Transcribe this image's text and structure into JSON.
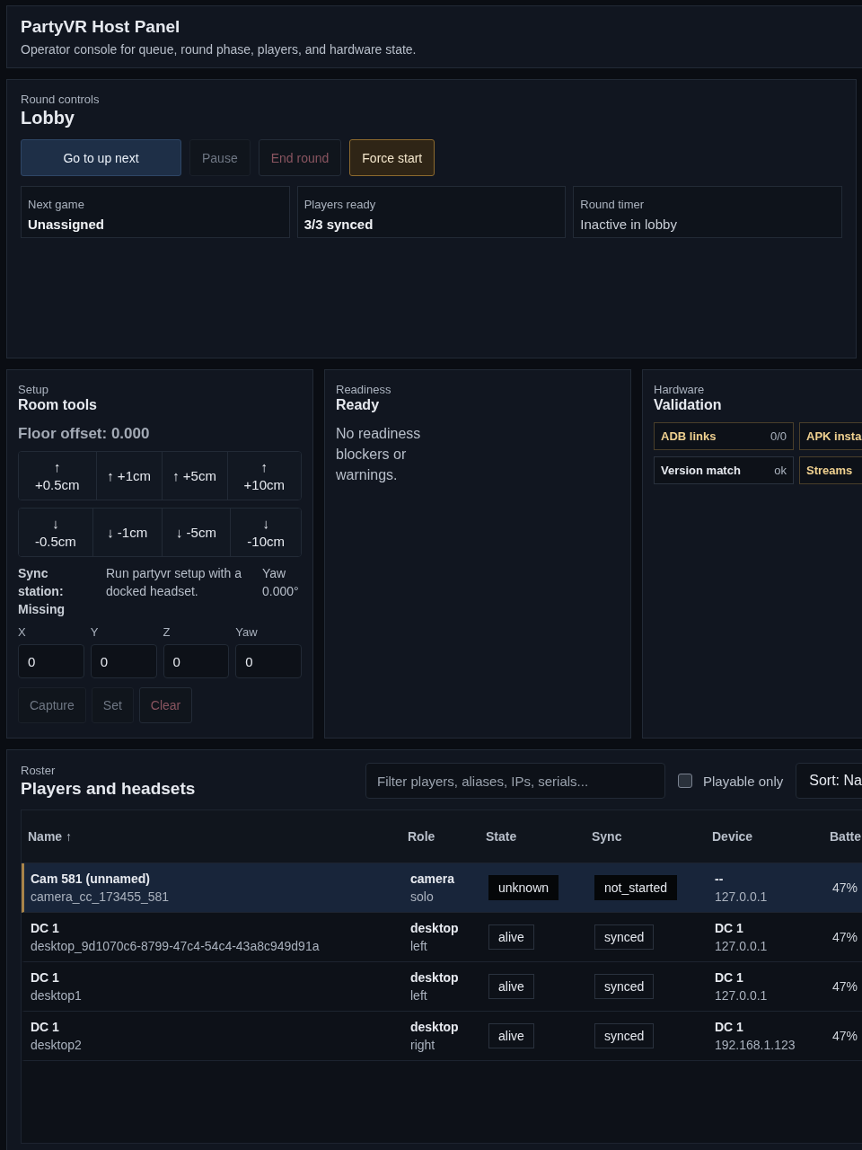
{
  "header": {
    "title": "PartyVR Host Panel",
    "subtitle": "Operator console for queue, round phase, players, and hardware state."
  },
  "round_controls": {
    "eyebrow": "Round controls",
    "title": "Lobby",
    "buttons": [
      {
        "label": "Go to up next",
        "kind": "primary"
      },
      {
        "label": "Pause",
        "kind": "disabled"
      },
      {
        "label": "End round",
        "kind": "danger"
      },
      {
        "label": "Force start",
        "kind": "warning"
      }
    ],
    "stats": [
      {
        "label": "Next game",
        "value": "Unassigned",
        "bold": true
      },
      {
        "label": "Players ready",
        "value": "3/3 synced",
        "bold": true
      },
      {
        "label": "Round timer",
        "value": "Inactive in lobby",
        "bold": false
      }
    ]
  },
  "setup": {
    "eyebrow": "Setup",
    "title": "Room tools",
    "floor_offset": "Floor offset: 0.000",
    "up_buttons": [
      {
        "arrow": "↑",
        "label": "+0.5cm",
        "stacked": true
      },
      {
        "arrow": "↑",
        "label": "+1cm",
        "stacked": false
      },
      {
        "arrow": "↑",
        "label": "+5cm",
        "stacked": false
      },
      {
        "arrow": "↑",
        "label": "+10cm",
        "stacked": true
      }
    ],
    "down_buttons": [
      {
        "arrow": "↓",
        "label": "-0.5cm",
        "stacked": true
      },
      {
        "arrow": "↓",
        "label": "-1cm",
        "stacked": false
      },
      {
        "arrow": "↓",
        "label": "-5cm",
        "stacked": false
      },
      {
        "arrow": "↓",
        "label": "-10cm",
        "stacked": true
      }
    ],
    "sync_station": "Sync station: Missing",
    "sync_hint": "Run partyvr setup with a docked headset.",
    "yaw_label": "Yaw",
    "yaw_value": "0.000°",
    "fields": [
      {
        "label": "X",
        "value": "0"
      },
      {
        "label": "Y",
        "value": "0"
      },
      {
        "label": "Z",
        "value": "0"
      },
      {
        "label": "Yaw",
        "value": "0"
      }
    ],
    "actions": [
      {
        "label": "Capture",
        "kind": "disabled"
      },
      {
        "label": "Set",
        "kind": "disabled"
      },
      {
        "label": "Clear",
        "kind": "danger"
      }
    ]
  },
  "readiness": {
    "eyebrow": "Readiness",
    "title": "Ready",
    "message": "No readiness blockers or warnings."
  },
  "hardware": {
    "eyebrow": "Hardware",
    "title": "Validation",
    "checks": [
      {
        "label": "ADB links",
        "value": "0/0",
        "warning": true
      },
      {
        "label": "APK insta",
        "warning": true
      },
      {
        "label": "Version match",
        "value": "ok",
        "warning": false
      },
      {
        "label": "Streams",
        "warning": true
      }
    ]
  },
  "roster": {
    "eyebrow": "Roster",
    "title": "Players and headsets",
    "filter": {
      "placeholder": "Filter players, aliases, IPs, serials..."
    },
    "playable_only": {
      "label": "Playable only",
      "checked": false
    },
    "sort": "Sort: Na",
    "columns": [
      "Name ↑",
      "Role",
      "State",
      "Sync",
      "Device",
      "Batte"
    ],
    "rows": [
      {
        "name": "Cam 581 (unnamed)",
        "id": "camera_cc_173455_581",
        "role": "camera",
        "side": "solo",
        "state": {
          "text": "unknown",
          "kind": "unknown"
        },
        "sync": {
          "text": "not_started",
          "kind": "unknown"
        },
        "device": "--",
        "ip": "127.0.0.1",
        "battery": "47%",
        "selected": true
      },
      {
        "name": "DC 1",
        "id": "desktop_9d1070c6-8799-47c4-54c4-43a8c949d91a",
        "role": "desktop",
        "side": "left",
        "state": {
          "text": "alive",
          "kind": "ok"
        },
        "sync": {
          "text": "synced",
          "kind": "ok"
        },
        "device": "DC 1",
        "ip": "127.0.0.1",
        "battery": "47%",
        "selected": false
      },
      {
        "name": "DC 1",
        "id": "desktop1",
        "role": "desktop",
        "side": "left",
        "state": {
          "text": "alive",
          "kind": "ok"
        },
        "sync": {
          "text": "synced",
          "kind": "ok"
        },
        "device": "DC 1",
        "ip": "127.0.0.1",
        "battery": "47%",
        "selected": false
      },
      {
        "name": "DC 1",
        "id": "desktop2",
        "role": "desktop",
        "side": "right",
        "state": {
          "text": "alive",
          "kind": "ok"
        },
        "sync": {
          "text": "synced",
          "kind": "ok"
        },
        "device": "DC 1",
        "ip": "192.168.1.123",
        "battery": "47%",
        "selected": false
      }
    ]
  }
}
